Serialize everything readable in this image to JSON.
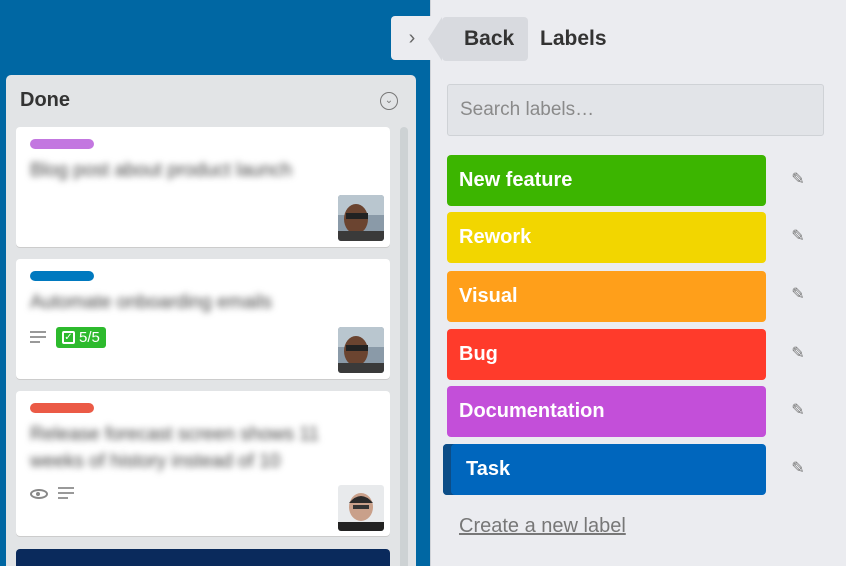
{
  "list": {
    "title": "Done",
    "menu_icon": "chevron-down-circle-icon"
  },
  "cards": [
    {
      "label_color": "#c377e0",
      "title": "Blog post about product launch",
      "avatar": "member-avatar"
    },
    {
      "label_color": "#0079bf",
      "title": "Automate onboarding emails",
      "checklist": "5/5",
      "avatar": "member-avatar"
    },
    {
      "label_color": "#eb5a46",
      "title_lines": [
        "Release forecast screen shows 11",
        "weeks of history instead of 10"
      ],
      "avatar": "member-avatar"
    }
  ],
  "panel": {
    "back_label": "Back",
    "title": "Labels",
    "search_placeholder": "Search labels…",
    "create_label": "Create a new label"
  },
  "labels": [
    {
      "name": "New feature",
      "color": "#3cb500"
    },
    {
      "name": "Rework",
      "color": "#f2d600"
    },
    {
      "name": "Visual",
      "color": "#ff9f1a"
    },
    {
      "name": "Bug",
      "color": "#ff3b2b"
    },
    {
      "name": "Documentation",
      "color": "#c34fd9"
    },
    {
      "name": "Task",
      "color": "#0066bd",
      "selected": true
    }
  ]
}
